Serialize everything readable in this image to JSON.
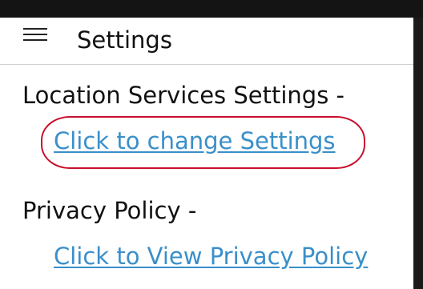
{
  "header": {
    "title": "Settings",
    "menu_icon": "hamburger-menu-icon"
  },
  "sections": [
    {
      "label": "Location Services Settings -",
      "link_text": "Click to change Settings"
    },
    {
      "label": "Privacy Policy -",
      "link_text": "Click to View Privacy Policy"
    }
  ],
  "colors": {
    "link": "#3a8fc9",
    "highlight": "#c8102e",
    "top_bar": "#141414"
  }
}
